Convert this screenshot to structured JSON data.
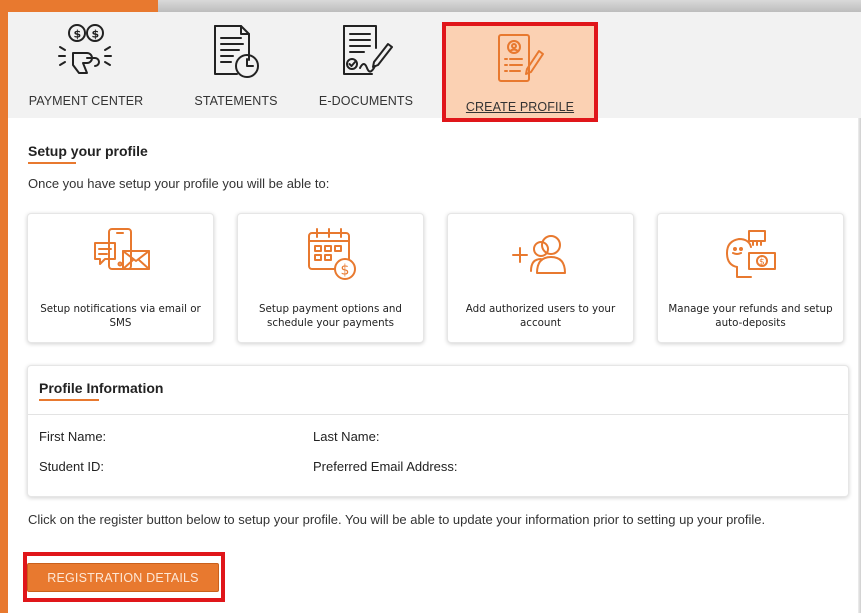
{
  "nav": {
    "tabs": [
      {
        "label": "PAYMENT CENTER",
        "icon": "payment-hand-icon"
      },
      {
        "label": "STATEMENTS",
        "icon": "statement-clock-icon"
      },
      {
        "label": "E-DOCUMENTS",
        "icon": "document-sign-icon"
      },
      {
        "label": "CREATE PROFILE",
        "icon": "profile-edit-icon",
        "active": true
      }
    ]
  },
  "setup": {
    "title": "Setup your profile",
    "intro": "Once you have setup your profile you will be able to:",
    "cards": [
      {
        "text": "Setup notifications via email or SMS",
        "icon": "phone-mail-icon"
      },
      {
        "text": "Setup payment options and schedule your payments",
        "icon": "calendar-payment-icon"
      },
      {
        "text": "Add authorized users to your account",
        "icon": "add-users-icon"
      },
      {
        "text": "Manage your refunds and setup auto-deposits",
        "icon": "refund-deposit-icon"
      }
    ]
  },
  "profile": {
    "title": "Profile Information",
    "first_name_label": "First Name:",
    "last_name_label": "Last Name:",
    "student_id_label": "Student ID:",
    "email_label": "Preferred Email Address:"
  },
  "register": {
    "note": "Click on the register button below to setup your profile. You will be able to update your information prior to setting up your profile.",
    "button_label": "REGISTRATION DETAILS"
  },
  "colors": {
    "accent": "#e8792f",
    "highlight": "#e0161a",
    "active_tab_bg": "#fbd1b3"
  }
}
